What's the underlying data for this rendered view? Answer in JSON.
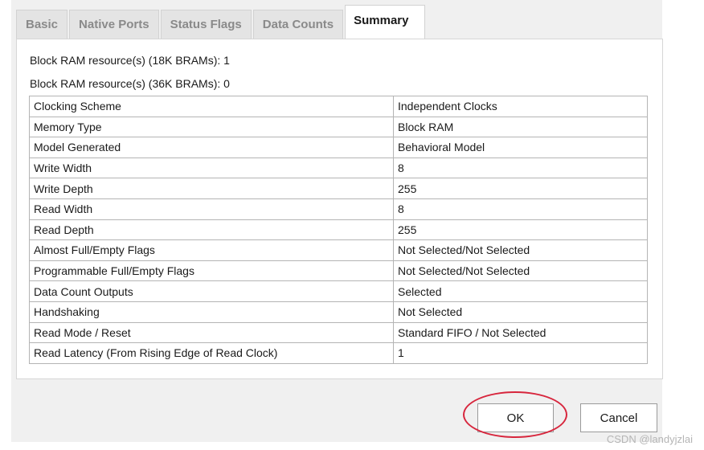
{
  "tabs": [
    {
      "label": "Basic"
    },
    {
      "label": "Native Ports"
    },
    {
      "label": "Status Flags"
    },
    {
      "label": "Data Counts"
    },
    {
      "label": "Summary"
    }
  ],
  "active_tab": "Summary",
  "bram": {
    "line_18k": "Block RAM resource(s) (18K BRAMs): 1",
    "line_36k": "Block RAM resource(s) (36K BRAMs): 0"
  },
  "summary_rows": [
    {
      "label": "Clocking Scheme",
      "value": "Independent Clocks"
    },
    {
      "label": "Memory Type",
      "value": "Block RAM"
    },
    {
      "label": "Model Generated",
      "value": "Behavioral Model"
    },
    {
      "label": "Write Width",
      "value": "8"
    },
    {
      "label": "Write Depth",
      "value": "255"
    },
    {
      "label": "Read Width",
      "value": "8"
    },
    {
      "label": "Read Depth",
      "value": "255"
    },
    {
      "label": "Almost Full/Empty Flags",
      "value": "Not Selected/Not Selected"
    },
    {
      "label": "Programmable Full/Empty Flags",
      "value": "Not Selected/Not Selected"
    },
    {
      "label": "Data Count Outputs",
      "value": "Selected"
    },
    {
      "label": "Handshaking",
      "value": "Not Selected"
    },
    {
      "label": "Read Mode / Reset",
      "value": "Standard FIFO / Not Selected"
    },
    {
      "label": "Read Latency (From Rising Edge of Read Clock)",
      "value": "1"
    }
  ],
  "buttons": {
    "ok_label": "OK",
    "cancel_label": "Cancel"
  },
  "highlight_color": "#d7263d",
  "watermark": "CSDN @landyjzlai"
}
